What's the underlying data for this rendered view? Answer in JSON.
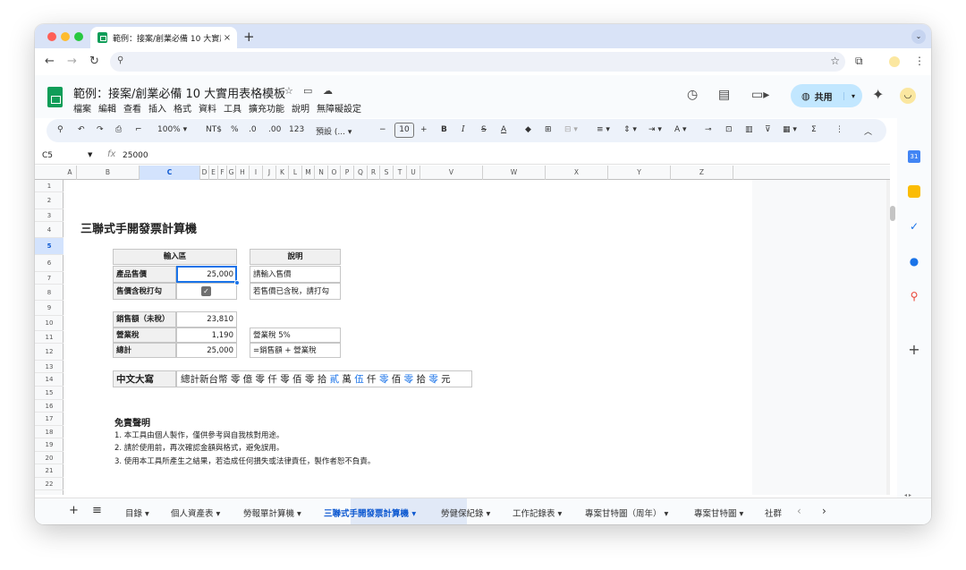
{
  "browser": {
    "tab_title": "範例：接案/創業必備 10 大實用",
    "tab_close": "×",
    "new_tab": "+",
    "tab_menu": "⌄",
    "nav": {
      "back": "←",
      "forward": "→",
      "reload": "↻"
    },
    "omnibox_icon": "⚲",
    "bookmark": "☆",
    "extensions": "⧉",
    "more": "⋮"
  },
  "sheets": {
    "doc_title": "範例：接案/創業必備 10 大實用表格模板",
    "menus": [
      "檔案",
      "編輯",
      "查看",
      "插入",
      "格式",
      "資料",
      "工具",
      "擴充功能",
      "說明",
      "無障礙設定"
    ],
    "share_label": "共用",
    "toolbar": {
      "zoom": "100%",
      "currency": "NT$",
      "percent": "%",
      "decrease_decimal": ".0",
      "increase_decimal": ".00",
      "number_format": "123",
      "font": "預設 (...",
      "font_size": "10",
      "bold": "B",
      "italic": "I",
      "strike": "S",
      "text_color": "A",
      "sum": "Σ"
    },
    "name_box": "C5",
    "fx": "fx",
    "formula_value": "25000"
  },
  "grid": {
    "columns": [
      "A",
      "B",
      "C",
      "D",
      "E",
      "F",
      "G",
      "H",
      "I",
      "J",
      "K",
      "L",
      "M",
      "N",
      "O",
      "P",
      "Q",
      "R",
      "S",
      "T",
      "U",
      "V",
      "W",
      "X",
      "Y",
      "Z"
    ],
    "rows": [
      "1",
      "2",
      "3",
      "4",
      "5",
      "6",
      "7",
      "8",
      "9",
      "10",
      "11",
      "12",
      "13",
      "14",
      "15",
      "16",
      "17",
      "18",
      "19",
      "20",
      "21",
      "22"
    ],
    "title": "三聯式手開發票計算機",
    "input_header": "輸入區",
    "note_header": "說明",
    "price_label": "產品售價",
    "price_value": "25,000",
    "price_note": "請輸入售價",
    "tax_included_label": "售價含稅打勾",
    "tax_included_checked": true,
    "tax_included_note": "若售價已含稅，請打勾",
    "sales_label": "銷售額（未稅）",
    "sales_value": "23,810",
    "vat_label": "營業稅",
    "vat_value": "1,190",
    "vat_note": "營業稅 5%",
    "total_label": "總計",
    "total_value": "25,000",
    "total_note": "=銷售額 + 營業稅",
    "chinese_label": "中文大寫",
    "chinese_prefix": "總計新台幣",
    "chinese_digits": [
      {
        "t": "零",
        "blue": false
      },
      {
        "t": "億",
        "blue": false
      },
      {
        "t": "零",
        "blue": false
      },
      {
        "t": "仟",
        "blue": false
      },
      {
        "t": "零",
        "blue": false
      },
      {
        "t": "佰",
        "blue": false
      },
      {
        "t": "零",
        "blue": false
      },
      {
        "t": "拾",
        "blue": false
      },
      {
        "t": "貳",
        "blue": true
      },
      {
        "t": "萬",
        "blue": false
      },
      {
        "t": "伍",
        "blue": true
      },
      {
        "t": "仟",
        "blue": false
      },
      {
        "t": "零",
        "blue": true
      },
      {
        "t": "佰",
        "blue": false
      },
      {
        "t": "零",
        "blue": true
      },
      {
        "t": "拾",
        "blue": false
      },
      {
        "t": "零",
        "blue": true
      },
      {
        "t": "元",
        "blue": false
      }
    ],
    "disclaimer_title": "免責聲明",
    "disclaimer_lines": [
      "1. 本工具由個人製作，僅供參考與自我核對用途。",
      "2. 請於使用前，再次確認金額與格式，避免誤用。",
      "3. 使用本工具所產生之結果，若造成任何損失或法律責任，製作者恕不負責。"
    ]
  },
  "sheet_tabs": {
    "add": "+",
    "all_sheets": "≡",
    "tabs": [
      "目錄",
      "個人資產表",
      "勞報單計算機",
      "三聯式手開發票計算機",
      "勞健保紀錄",
      "工作記錄表",
      "專案甘特圖（周年）",
      "專案甘特圖",
      "社群"
    ],
    "active_index": 3,
    "scroll_left": "‹",
    "scroll_right": "›"
  },
  "colors": {
    "accent": "#0b57d0",
    "share_bg": "#c2e7ff",
    "selection": "#1a73e8",
    "sheets_green": "#0f9d58"
  }
}
